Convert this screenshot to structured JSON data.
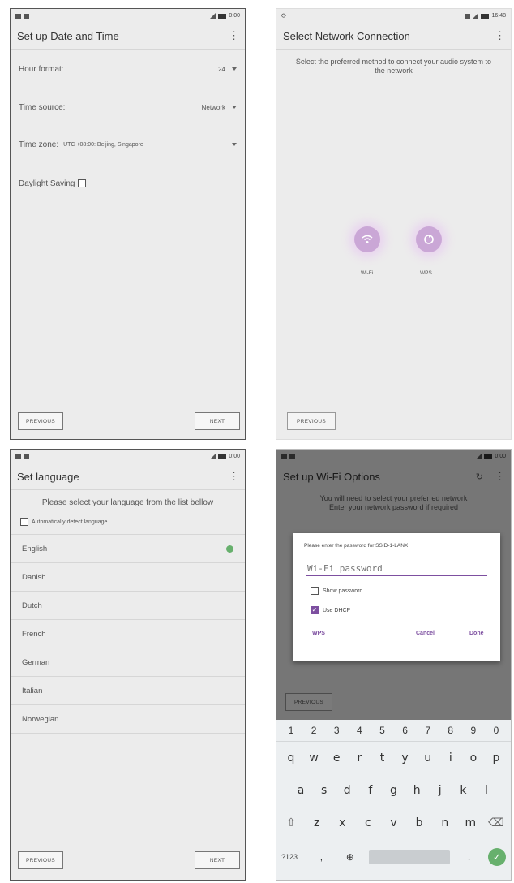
{
  "colors": {
    "accent": "#7d4fa0",
    "check_green": "#67b06d"
  },
  "screen1": {
    "title": "Set up Date and Time",
    "status_time": "0:00",
    "hour_format_label": "Hour format:",
    "hour_format_value": "24",
    "time_source_label": "Time source:",
    "time_source_value": "Network",
    "time_zone_label": "Time zone:",
    "time_zone_value": "UTC +08:00: Beijing, Singapore",
    "daylight_label": "Daylight Saving",
    "previous": "PREVIOUS",
    "next": "NEXT"
  },
  "screen2": {
    "title": "Select Network Connection",
    "status_time": "16:48",
    "instruction": "Select the preferred method to connect your audio system to the network",
    "wifi_label": "Wi-Fi",
    "wps_label": "WPS",
    "previous": "PREVIOUS"
  },
  "screen3": {
    "title": "Set language",
    "status_time": "0:00",
    "instruction": "Please select your language from the list bellow",
    "auto_detect": "Automatically detect language",
    "languages": [
      "English",
      "Danish",
      "Dutch",
      "French",
      "German",
      "Italian",
      "Norwegian"
    ],
    "selected_index": 0,
    "previous": "PREVIOUS",
    "next": "NEXT"
  },
  "screen4": {
    "title": "Set up Wi-Fi Options",
    "status_time": "0:00",
    "bg_text_line1": "You will need to select your preferred network",
    "bg_text_line2": "Enter your network password if required",
    "previous": "PREVIOUS",
    "dialog": {
      "prompt": "Please enter the password for SSID-1-LANX",
      "password_placeholder": "Wi-Fi password",
      "show_password": "Show password",
      "use_dhcp": "Use DHCP",
      "use_dhcp_checked": true,
      "wps": "WPS",
      "cancel": "Cancel",
      "done": "Done"
    },
    "keyboard": {
      "numbers": [
        "1",
        "2",
        "3",
        "4",
        "5",
        "6",
        "7",
        "8",
        "9",
        "0"
      ],
      "row1": [
        "q",
        "w",
        "e",
        "r",
        "t",
        "y",
        "u",
        "i",
        "o",
        "p"
      ],
      "row2": [
        "a",
        "s",
        "d",
        "f",
        "g",
        "h",
        "j",
        "k",
        "l"
      ],
      "row3": [
        "z",
        "x",
        "c",
        "v",
        "b",
        "n",
        "m"
      ],
      "symbols_key": "?123",
      "comma": ",",
      "period": "."
    }
  }
}
